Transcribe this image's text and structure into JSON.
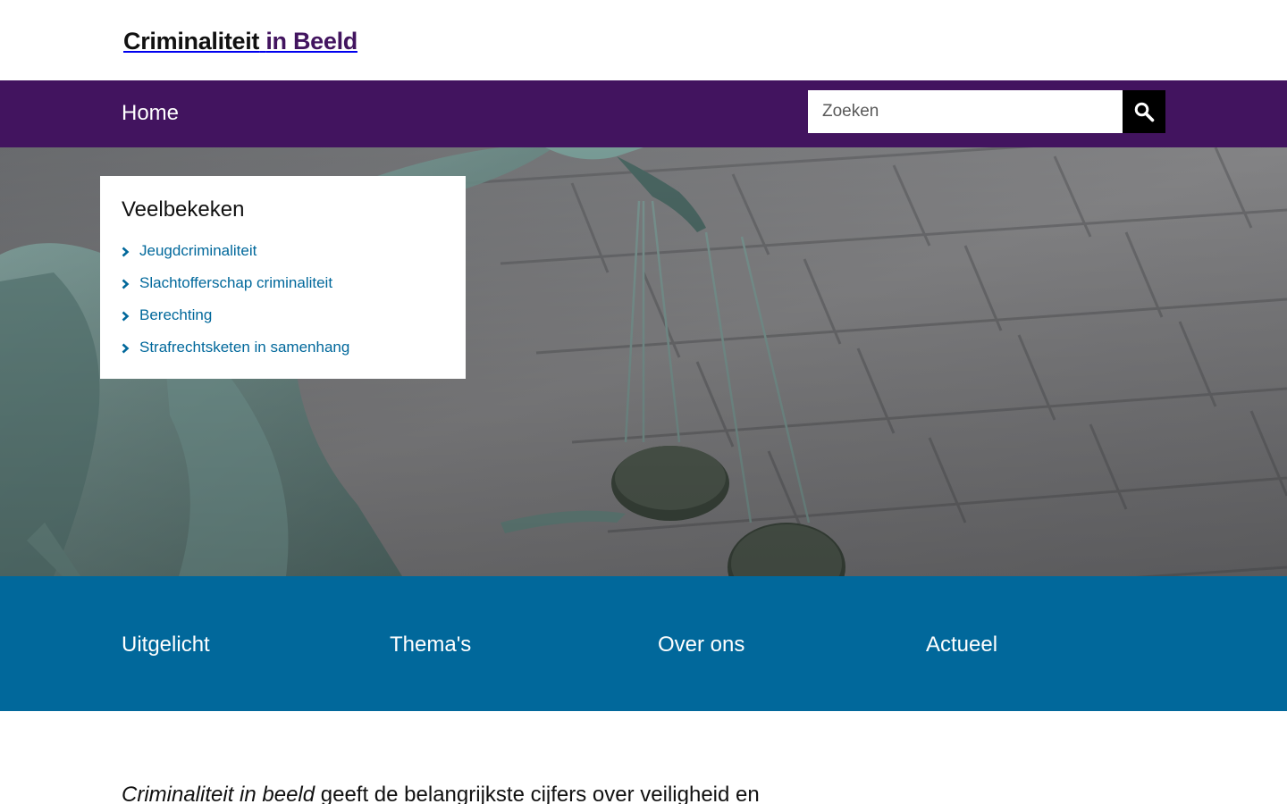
{
  "header": {
    "logo_part1": "Criminaliteit",
    "logo_part2": "in Beeld"
  },
  "nav": {
    "home_label": "Home",
    "search_placeholder": "Zoeken",
    "search_icon": "magnifier-icon"
  },
  "popular": {
    "title": "Veelbekeken",
    "items": [
      {
        "label": "Jeugdcriminaliteit"
      },
      {
        "label": "Slachtofferschap criminaliteit"
      },
      {
        "label": "Berechting"
      },
      {
        "label": "Strafrechtsketen in samenhang"
      }
    ],
    "chevron_icon": "chevron-right-icon"
  },
  "band": {
    "items": [
      {
        "label": "Uitgelicht"
      },
      {
        "label": "Thema's"
      },
      {
        "label": "Over ons"
      },
      {
        "label": "Actueel"
      }
    ]
  },
  "intro": {
    "italic": "Criminaliteit in beeld",
    "rest": " geeft de belangrijkste cijfers over veiligheid en"
  },
  "colors": {
    "brand_purple": "#42145f",
    "link_blue": "#01689b",
    "band_blue": "#01689b"
  }
}
